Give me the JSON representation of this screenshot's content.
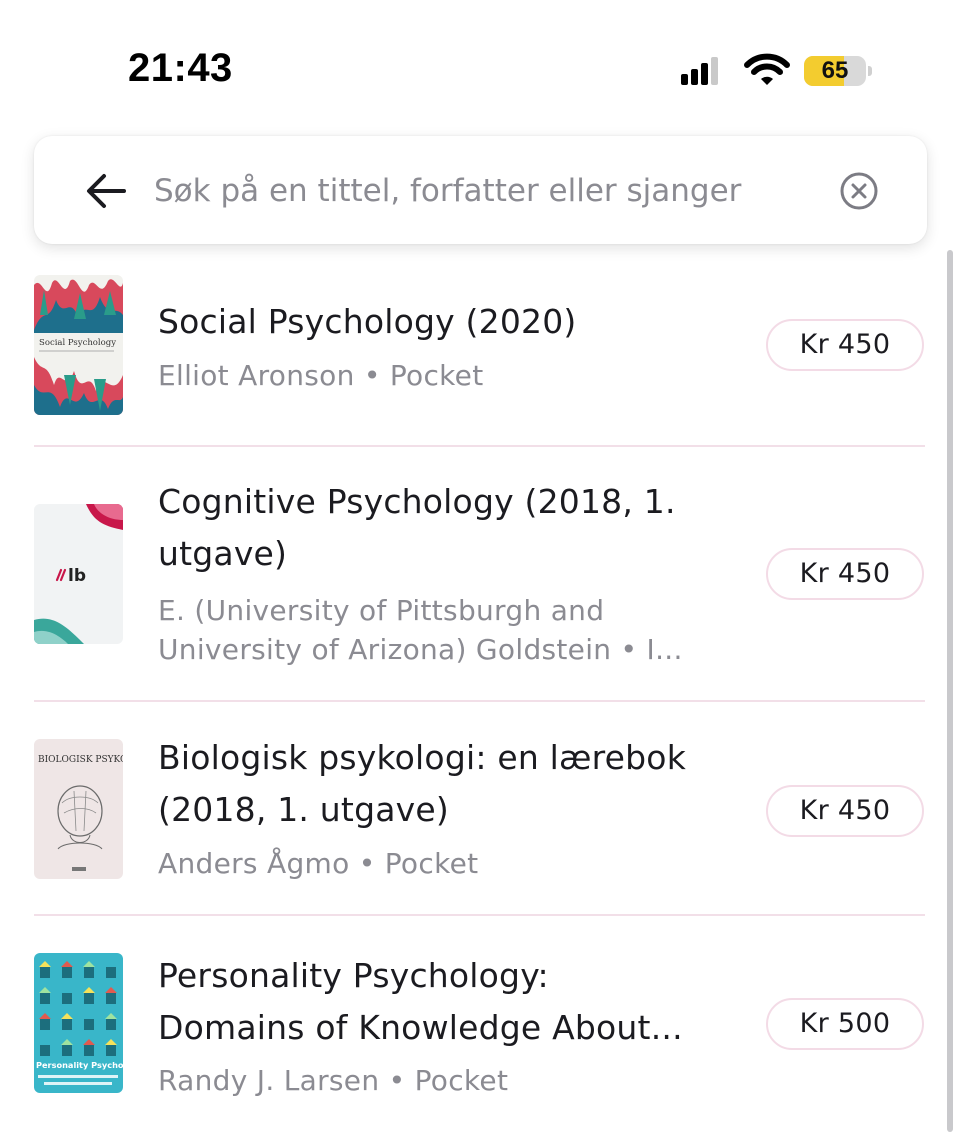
{
  "status_bar": {
    "time": "21:43",
    "battery_level": "65",
    "battery_fraction": 0.65,
    "icons": [
      "cellular-signal-icon",
      "wifi-icon",
      "battery-icon"
    ]
  },
  "search": {
    "placeholder": "Søk på en tittel, forfatter eller sjanger",
    "value": "",
    "back_icon": "arrow-left-icon",
    "clear_icon": "clear-circle-icon"
  },
  "results": [
    {
      "title_lines": [
        " Social Psychology (2020)"
      ],
      "meta_lines": [
        "Elliot Aronson • Pocket"
      ],
      "price": "Kr 450",
      "cover": {
        "title_text": "Social Psychology",
        "colors": [
          "#1e6f8c",
          "#d8495c",
          "#2a9c8a",
          "#f2f2ee"
        ]
      }
    },
    {
      "title_lines": [
        "Cognitive Psychology (2018, 1.",
        "utgave)"
      ],
      "meta_lines": [
        "E. (University of Pittsburgh and",
        "University of Arizona) Goldstein • I..."
      ],
      "price": "Kr 450",
      "cover": {
        "logo_text": "lb",
        "colors": [
          "#f1f3f4",
          "#c8174a",
          "#3aa79b"
        ]
      }
    },
    {
      "title_lines": [
        "Biologisk psykologi: en lærebok",
        "(2018, 1. utgave)"
      ],
      "meta_lines": [
        "Anders Ågmo • Pocket"
      ],
      "price": "Kr 450",
      "cover": {
        "title_text": "BIOLOGISK PSYKOLOGI",
        "colors": [
          "#efe6e6",
          "#6b6b6b"
        ]
      }
    },
    {
      "title_lines": [
        "Personality Psychology:",
        "Domains of Knowledge About..."
      ],
      "meta_lines": [
        "Randy J. Larsen • Pocket"
      ],
      "price": "Kr 500",
      "cover": {
        "title_text": "Personality Psychology",
        "colors": [
          "#39b6c9",
          "#f4e25b",
          "#e25a4f",
          "#1c6e7d"
        ]
      }
    }
  ]
}
